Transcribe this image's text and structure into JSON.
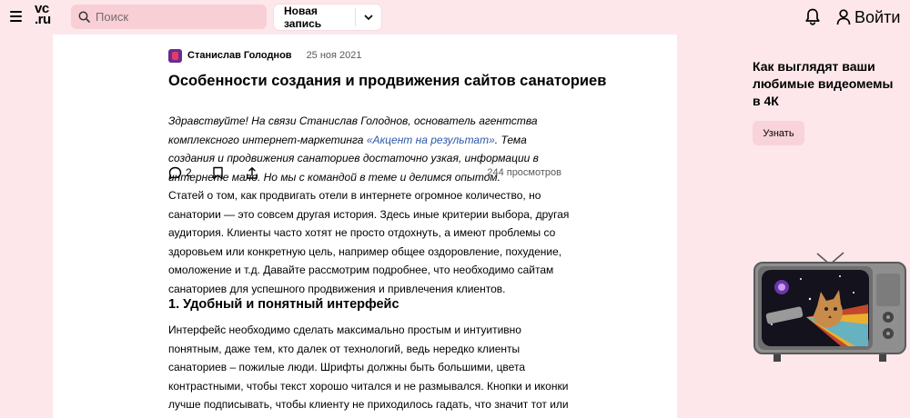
{
  "header": {
    "logo_line1": "vc",
    "logo_line2": ".ru",
    "search_placeholder": "Поиск",
    "new_post_label": "Новая запись",
    "login_label": "Войти"
  },
  "article": {
    "author": "Станислав Голоднов",
    "date": "25 ноя 2021",
    "title": "Особенности создания и продвижения сайтов санаториев",
    "lead_before": "Здравствуйте! На связи Станислав Голоднов, основатель агентства комплексного интернет-маркетинга ",
    "lead_link": "«Акцент на результат»",
    "lead_after": ". Тема создания и продвижения санаториев достаточно узкая, информации в интернете мало. Но мы с командой в теме и делимся опытом.",
    "comments_count": "2",
    "views": "244 просмотров",
    "paragraph1": "Статей о том, как продвигать отели в интернете огромное количество, но санатории — это совсем другая история. Здесь иные критерии выбора, другая аудитория. Клиенты часто хотят не просто отдохнуть, а имеют проблемы со здоровьем или конкретную цель, например общее оздоровление, похудение, омоложение и т.д. Давайте рассмотрим подробнее, что необходимо сайтам санаториев для успешного продвижения и привлечения клиентов.",
    "heading1": "1. Удобный и понятный интерфейс",
    "paragraph2": "Интерфейс необходимо сделать максимально простым и интуитивно понятным, даже тем, кто далек от технологий, ведь нередко клиенты санаториев – пожилые люди. Шрифты должны быть большими, цвета контрастными, чтобы текст хорошо читался и не размывался. Кнопки и иконки лучше подписывать, чтобы клиенту не приходилось гадать, что значит тот или иной знак."
  },
  "sidebar": {
    "promo_title": "Как выглядят ваши любимые видеомемы в 4К",
    "promo_button": "Узнать"
  },
  "colors": {
    "page_background": "#fde7ea",
    "search_background": "#f7cfd5",
    "link": "#2c59a8",
    "secondary_text": "#595959"
  },
  "icons": [
    "menu-icon",
    "search-icon",
    "chevron-down-icon",
    "bell-icon",
    "user-icon",
    "comment-icon",
    "bookmark-icon",
    "share-icon"
  ]
}
